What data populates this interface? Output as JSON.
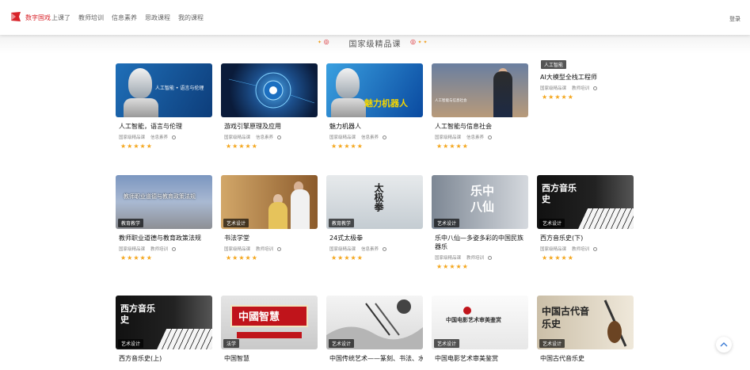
{
  "header": {
    "brand": "数字国戏",
    "nav": [
      "上课了",
      "教师培训",
      "信息素养",
      "思政课程",
      "我的课程"
    ],
    "login": "登录"
  },
  "section": {
    "title": "国家级精品课"
  },
  "colors": {
    "brand": "#d8232a",
    "star": "#f4a61c"
  },
  "courses": [
    {
      "title": "人工智能，语言与伦理",
      "tag": "",
      "meta1": "国家级精品课",
      "meta2": "信息素养",
      "stars": "★★★★★",
      "thumb_text": "人工智能 • 语言与伦理"
    },
    {
      "title": "游戏引擎原理及应用",
      "tag": "",
      "meta1": "国家级精品课",
      "meta2": "信息素养",
      "stars": "★★★★★",
      "thumb_text": ""
    },
    {
      "title": "魅力机器人",
      "tag": "",
      "meta1": "国家级精品课",
      "meta2": "信息素养",
      "stars": "★★★★★",
      "thumb_text": "魅力机器人"
    },
    {
      "title": "人工智能与信息社会",
      "tag": "",
      "meta1": "国家级精品课",
      "meta2": "信息素养",
      "stars": "★★★★★",
      "thumb_text": "人工智能与信息社会"
    },
    {
      "title": "AI大模型全栈工程师",
      "tag": "人工智能",
      "meta1": "国家级精品课",
      "meta2": "教师培训",
      "stars": "★★★★★",
      "thumb_text": ""
    },
    {
      "title": "教师职业道德与教育政策法规",
      "tag": "教育教学",
      "meta1": "国家级精品课",
      "meta2": "教师培训",
      "stars": "★★★★★",
      "thumb_text": "教师职业道德与教育政策法规"
    },
    {
      "title": "书法学堂",
      "tag": "艺术设计",
      "meta1": "国家级精品课",
      "meta2": "教师培训",
      "stars": "★★★★★",
      "thumb_text": ""
    },
    {
      "title": "24式太极拳",
      "tag": "教育教学",
      "meta1": "国家级精品课",
      "meta2": "信息素养",
      "stars": "★★★★★",
      "thumb_text": "太极拳"
    },
    {
      "title": "乐中八仙—多姿多彩的中国民族器乐",
      "tag": "艺术设计",
      "meta1": "国家级精品课",
      "meta2": "教师培训",
      "stars": "★★★★★",
      "thumb_text": "乐中八仙"
    },
    {
      "title": "西方音乐史(下)",
      "tag": "艺术设计",
      "meta1": "国家级精品课",
      "meta2": "教师培训",
      "stars": "★★★★★",
      "thumb_text": "西方音乐史"
    },
    {
      "title": "西方音乐史(上)",
      "tag": "艺术设计",
      "meta1": "",
      "meta2": "",
      "stars": "",
      "thumb_text": "西方音乐史"
    },
    {
      "title": "中国智慧",
      "tag": "法学",
      "meta1": "",
      "meta2": "",
      "stars": "",
      "thumb_text": "中國智慧"
    },
    {
      "title": "中国传统艺术——篆刻、书法、水墨画体验与欣赏",
      "tag": "艺术设计",
      "meta1": "",
      "meta2": "",
      "stars": "",
      "thumb_text": ""
    },
    {
      "title": "中国电影艺术审美鉴赏",
      "tag": "艺术设计",
      "meta1": "",
      "meta2": "",
      "stars": "",
      "thumb_text": "中国电影艺术审美鉴赏"
    },
    {
      "title": "中国古代音乐史",
      "tag": "艺术设计",
      "meta1": "",
      "meta2": "",
      "stars": "",
      "thumb_text": "中国古代音乐史"
    }
  ]
}
